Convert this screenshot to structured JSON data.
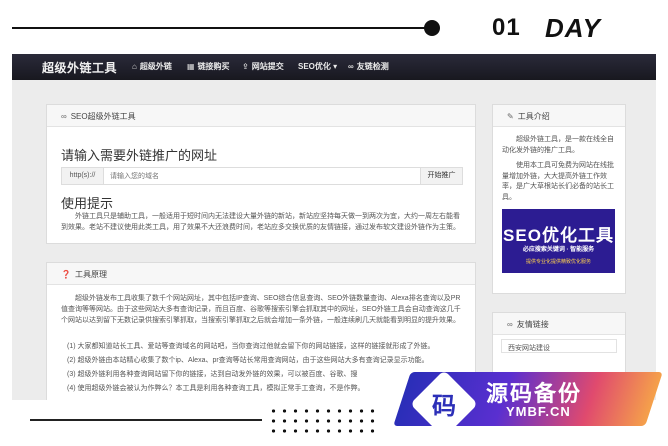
{
  "banner": {
    "num": "01",
    "word": "DAY"
  },
  "nav": {
    "brand": "超级外链工具",
    "items": [
      {
        "icon": "home-icon",
        "glyph": "⌂",
        "label": "超级外链"
      },
      {
        "icon": "grid-icon",
        "glyph": "▦",
        "label": "链接购买"
      },
      {
        "icon": "upload-icon",
        "glyph": "⇪",
        "label": "网站提交"
      },
      {
        "icon": "",
        "glyph": "",
        "label": "SEO优化 ▾"
      },
      {
        "icon": "link-icon",
        "glyph": "∞",
        "label": "友链检测"
      }
    ]
  },
  "main": {
    "header": "SEO超级外链工具",
    "heading": "请输入需要外链推广的网址",
    "url_prefix": "http(s)://",
    "url_placeholder": "请输入您的域名",
    "submit_label": "开始推广",
    "tips_title": "使用提示",
    "tips_text": "外链工具只是辅助工具，一般适用于短时间内无法建设大量外链的新站，新站应坚持每天做一到两次为宜，大约一周左右能看到效果。老站不建议使用此类工具，用了效果不大还浪费时间，老站应多交换优质的友情链接，通过发布软文建设外链作为主策。"
  },
  "principle": {
    "header": "工具原理",
    "intro": "超级外链发布工具收集了数千个网站网址，其中包括IP查询、SEO综合信息查询、SEO外链数量查询、Alexa排名查询以及PR值查询等等网站。由于这些网站大多有查询记录，而且百度、谷歌等搜索引擎会抓取其中的网址，SEO外链工具会自动查询这几千个网站以达到留下无数记录供搜索引擎抓取，当搜索引擎抓取之后就会增加一条外链，一般连续刷几天就能看到明显的提升效果。",
    "items": [
      "(1)  大家都知道站长工具、爱站等查询域名的网站吧，当你查询过他就会留下你的网站链接，这样的链接就形成了外链。",
      "(2)  超级外链由本站精心收集了数个ip、Alexa、pr查询等站长常用查询网站，由于这些网站大多有查询记录显示功能。",
      "(3)  超级外链利用各种查询网站留下你的链接，达到自动发外链的效果，可以被百度、谷歌、搜",
      "(4)  使用超级外链会被认为作弊么？本工具是利用各种查询工具，模拟正常手工查询，不是作弊。"
    ]
  },
  "sidebar": {
    "intro_header": "工具介绍",
    "intro_p1": "超级外链工具，是一款在线全自动化发外链的推广工具。",
    "intro_p2": "使用本工具可免费为网站在线批量增加外链，大大提高外链工作效率，是广大草根站长们必备的站长工具。",
    "seo_title": "SEO优化工具",
    "seo_sub": "必应搜索关键词 · 智能服务",
    "seo_sub2": "提供专业化提供精致优化服务",
    "links_header": "友情链接",
    "link_item": "西安网站建设"
  },
  "watermark": {
    "badge": "码",
    "big": "源码备份",
    "small": "YMBF.CN"
  }
}
